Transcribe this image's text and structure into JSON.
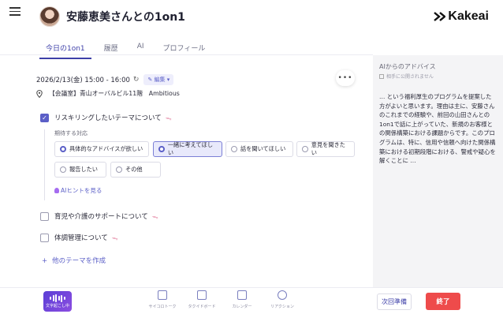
{
  "header": {
    "title": "安藤恵美さんとの1on1",
    "brand": "Kakeai"
  },
  "tabs": [
    {
      "label": "今日の1on1",
      "active": true
    },
    {
      "label": "履歴",
      "active": false
    },
    {
      "label": "AI",
      "active": false
    },
    {
      "label": "プロフィール",
      "active": false
    }
  ],
  "meeting": {
    "datetime": "2026/2/13(金) 15:00 - 16:00",
    "edit_label": "編集",
    "location": "【会議室】青山オーバルビル11階　Ambitious"
  },
  "themes": [
    {
      "label": "リスキリングしたいテーマについて",
      "checked": true
    },
    {
      "label": "育児や介護のサポートについて",
      "checked": false
    },
    {
      "label": "体調管理について",
      "checked": false
    }
  ],
  "expected": {
    "label": "期待する対応",
    "options": [
      {
        "label": "具体的なアドバイスが欲しい",
        "selected": false
      },
      {
        "label": "一緒に考えてほしい",
        "selected": true
      },
      {
        "label": "話を聞いてほしい",
        "selected": false
      },
      {
        "label": "意見を聞きたい",
        "selected": false
      },
      {
        "label": "報告したい",
        "selected": false
      },
      {
        "label": "その他",
        "selected": false
      }
    ]
  },
  "ai_hint": "AIヒントを見る",
  "create_theme": "他のテーマを作成",
  "advice": {
    "title": "AIからのアドバイス",
    "subtitle": "相手に公開されません",
    "body": "… という福利厚生のプログラムを提案した方がよいと思います。理由は主に、安藤さんのこれまでの経験や、前回の山田さんとの1on1で話に上がっていた、新規のお客様との関係構築における課題からです。このプログラムは、特に、信用や信頼へ向けた関係構築における初期段階における、警戒や疑心を解くことに …"
  },
  "bottom": {
    "transcribe": "文字起こし中",
    "tools": [
      "サイコロトーク",
      "タクイドボード",
      "カレンダー",
      "リアクション"
    ],
    "next_label": "次回準備",
    "end_label": "終了"
  },
  "colors": {
    "accent": "#5b5fc7",
    "end": "#ee4b4b"
  }
}
